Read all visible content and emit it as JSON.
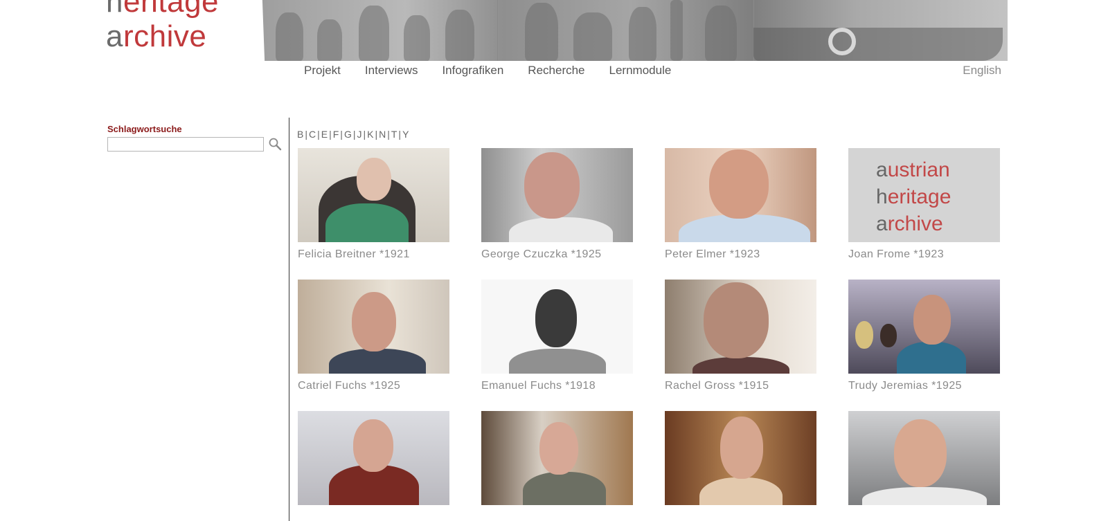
{
  "logo": {
    "line1_prefix": "h",
    "line1_rest": "eritage",
    "line2_prefix": "a",
    "line2_rest": "rchive"
  },
  "nav": {
    "items": [
      {
        "label": "Projekt"
      },
      {
        "label": "Interviews"
      },
      {
        "label": "Infografiken"
      },
      {
        "label": "Recherche"
      },
      {
        "label": "Lernmodule"
      }
    ],
    "language": "English"
  },
  "sidebar": {
    "search_label": "Schlagwortsuche",
    "search_value": "",
    "search_icon": "magnifier-icon"
  },
  "alphabet": [
    "B",
    "C",
    "E",
    "F",
    "G",
    "J",
    "K",
    "N",
    "T",
    "Y"
  ],
  "interviews": [
    {
      "caption": "Felicia Breitner *1921"
    },
    {
      "caption": "George Czuczka *1925"
    },
    {
      "caption": "Peter Elmer *1923"
    },
    {
      "caption": "Joan Frome *1923",
      "placeholder": {
        "l1a": "a",
        "l1b": "ustrian",
        "l2a": "h",
        "l2b": "eritage",
        "l3a": "a",
        "l3b": "rchive"
      }
    },
    {
      "caption": "Catriel Fuchs *1925"
    },
    {
      "caption": "Emanuel Fuchs *1918"
    },
    {
      "caption": "Rachel Gross *1915"
    },
    {
      "caption": "Trudy Jeremias *1925"
    },
    {
      "caption": ""
    },
    {
      "caption": ""
    },
    {
      "caption": ""
    },
    {
      "caption": ""
    }
  ]
}
